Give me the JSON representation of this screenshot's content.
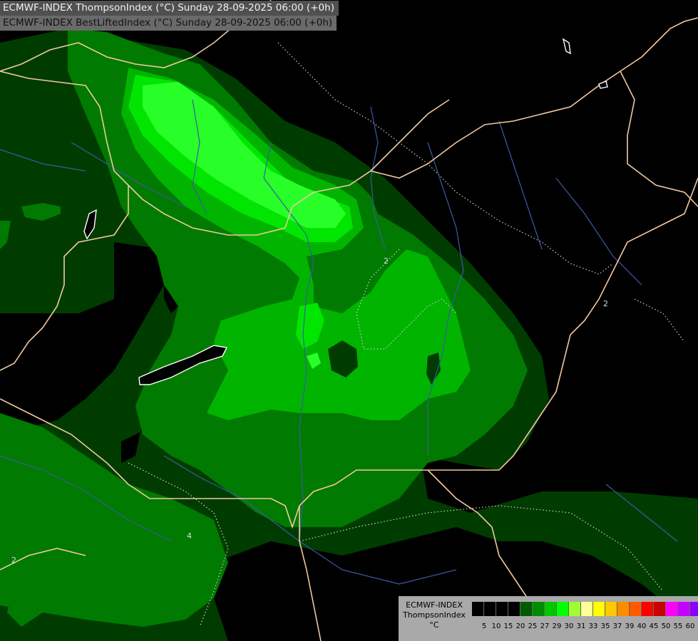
{
  "titles": {
    "line1": "ECMWF-INDEX ThompsonIndex (°C) Sunday 28-09-2025 06:00 (+0h)",
    "line2": "ECMWF-INDEX BestLiftedIndex (°C) Sunday 28-09-2025 06:00 (+0h)"
  },
  "legend": {
    "line1": "ECMWF-INDEX",
    "line2": "ThompsonIndex",
    "line3": "°C",
    "colors": [
      "#000000",
      "#000000",
      "#000000",
      "#000000",
      "#005a00",
      "#008c00",
      "#00c800",
      "#00ff00",
      "#a0ff32",
      "#ffff96",
      "#ffff00",
      "#ffc800",
      "#ff8c00",
      "#ff5a00",
      "#ff0000",
      "#c80000",
      "#ff00ff",
      "#c800ff",
      "#8c00ff",
      "#5000ff",
      "#0000ff"
    ],
    "ticks": [
      "5",
      "10",
      "15",
      "20",
      "25",
      "27",
      "29",
      "30",
      "31",
      "33",
      "35",
      "37",
      "39",
      "40",
      "45",
      "50",
      "55",
      "60"
    ]
  },
  "map": {
    "field_colors": {
      "dark_green": "#003c00",
      "mid_green": "#007a00",
      "bright_green": "#00b400",
      "light_green": "#00e600",
      "lime": "#28ff28",
      "black": "#000000"
    },
    "border_color": "#f0c8a0",
    "river_color": "#3c5aa0",
    "contour_labels": [
      "2",
      "2",
      "4",
      "2"
    ]
  }
}
